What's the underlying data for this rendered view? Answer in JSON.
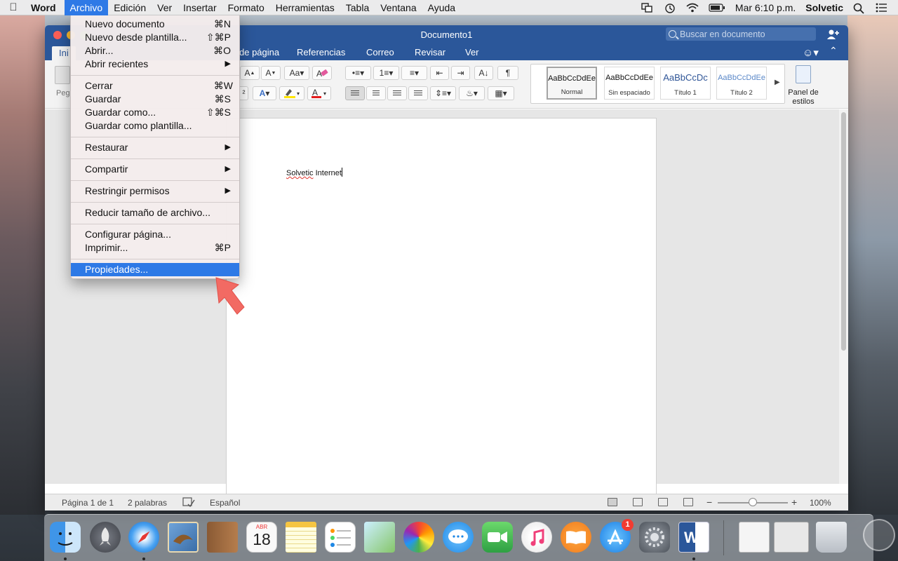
{
  "menubar": {
    "app_name": "Word",
    "items": [
      "Archivo",
      "Edición",
      "Ver",
      "Insertar",
      "Formato",
      "Herramientas",
      "Tabla",
      "Ventana",
      "Ayuda"
    ],
    "clock": "Mar 6:10 p.m.",
    "user": "Solvetic"
  },
  "window": {
    "title": "Documento1",
    "search_placeholder": "Buscar en documento",
    "tabs": [
      "Ini",
      "de página",
      "Referencias",
      "Correo",
      "Revisar",
      "Ver"
    ]
  },
  "ribbon": {
    "paste_label": "Peg",
    "styles": [
      "Normal",
      "Sin espaciado",
      "Título 1",
      "Título 2"
    ],
    "style_sample": "AaBbCcDdEe",
    "title1_sample": "AaBbCcDc",
    "panel_label": "Panel de estilos"
  },
  "document": {
    "word1": "Solvetic",
    "word2": "Internet"
  },
  "statusbar": {
    "page": "Página 1 de 1",
    "words": "2 palabras",
    "language": "Español",
    "zoom": "100%"
  },
  "file_menu": {
    "new": "Nuevo documento",
    "new_sc": "⌘N",
    "new_template": "Nuevo desde plantilla...",
    "new_template_sc": "⇧⌘P",
    "open": "Abrir...",
    "open_sc": "⌘O",
    "open_recent": "Abrir recientes",
    "close": "Cerrar",
    "close_sc": "⌘W",
    "save": "Guardar",
    "save_sc": "⌘S",
    "save_as": "Guardar como...",
    "save_as_sc": "⇧⌘S",
    "save_template": "Guardar como plantilla...",
    "restore": "Restaurar",
    "share": "Compartir",
    "restrict": "Restringir permisos",
    "reduce": "Reducir tamaño de archivo...",
    "page_setup": "Configurar página...",
    "print": "Imprimir...",
    "print_sc": "⌘P",
    "properties": "Propiedades..."
  },
  "dock": {
    "calendar_month": "ABR",
    "calendar_day": "18",
    "appstore_badge": "1"
  },
  "colors": {
    "word_blue": "#2b579a",
    "menu_highlight": "#2e79e6",
    "pointer_arrow": "#f26a63"
  }
}
